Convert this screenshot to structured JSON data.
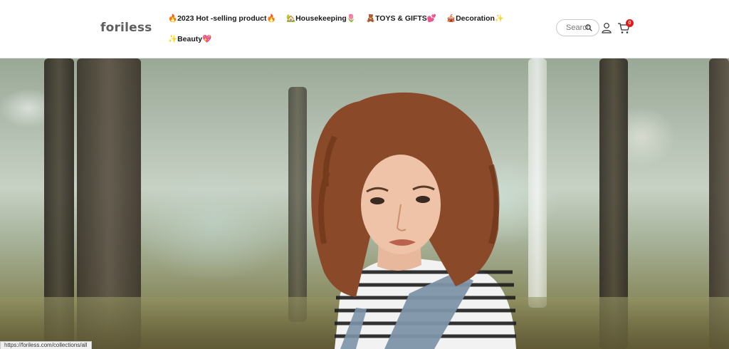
{
  "brand": {
    "name": "foriless"
  },
  "nav": {
    "items": [
      {
        "label": "🔥2023 Hot -selling product🔥"
      },
      {
        "label": "🏡Housekeeping🌷"
      },
      {
        "label": "🧸TOYS & GIFTS💕"
      },
      {
        "label": "🎪Decoration✨"
      },
      {
        "label": "✨Beauty💖"
      }
    ]
  },
  "header_actions": {
    "search_label": "Search",
    "cart_count": "0"
  },
  "hero": {
    "image_description_icon": "hero-photo"
  },
  "status_bar": {
    "url": "https://foriless.com/collections/all"
  },
  "colors": {
    "badge": "#e21a1a",
    "text": "#1a1a1a",
    "logo": "#5f5f5f"
  }
}
